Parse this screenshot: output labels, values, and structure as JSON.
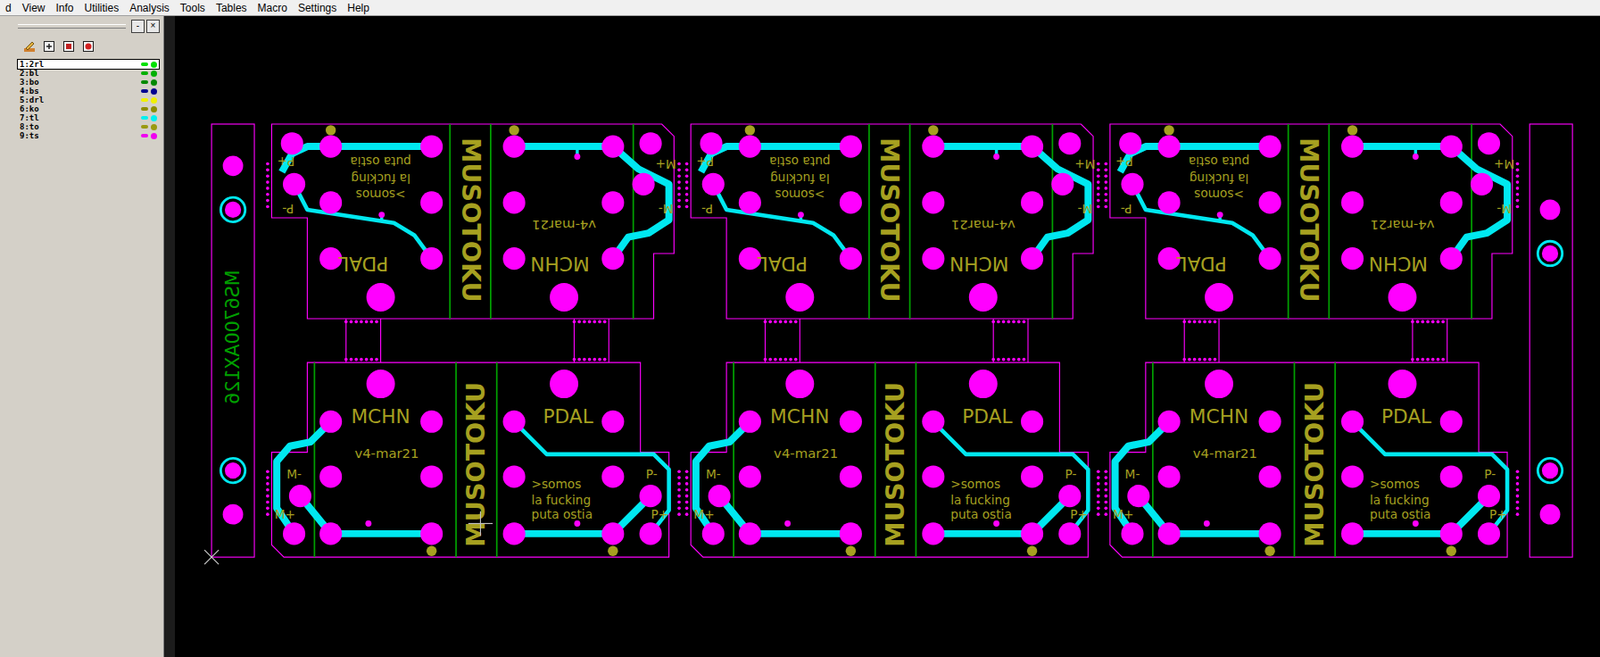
{
  "window": {
    "menu": [
      "d",
      "View",
      "Info",
      "Utilities",
      "Analysis",
      "Tools",
      "Tables",
      "Macro",
      "Settings",
      "Help"
    ]
  },
  "side_panel": {
    "buttons": [
      "-",
      "×"
    ],
    "layers": [
      {
        "name": "1:2rl",
        "selected": true,
        "color": "#00e000"
      },
      {
        "name": "2:bl",
        "selected": false,
        "color": "#00b000"
      },
      {
        "name": "3:bo",
        "selected": false,
        "color": "#008800"
      },
      {
        "name": "4:bs",
        "selected": false,
        "color": "#000090"
      },
      {
        "name": "5:drl",
        "selected": false,
        "color": "#f0f000"
      },
      {
        "name": "6:ko",
        "selected": false,
        "color": "#8c8c00"
      },
      {
        "name": "7:tl",
        "selected": false,
        "color": "#00f0f0"
      },
      {
        "name": "8:to",
        "selected": false,
        "color": "#9a9a10"
      },
      {
        "name": "9:ts",
        "selected": false,
        "color": "#f000f0"
      }
    ]
  },
  "canvas": {
    "rail_text": "MS6700AX126",
    "boards": [
      {
        "top": {
          "brand": "MUSOTOKU",
          "pedal": "PDAL",
          "machine": "MCHN",
          "version": "v4-mar21",
          "slogan": [
            ">somos",
            "la fucking",
            "puta ostia"
          ],
          "p_plus": "P+",
          "p_minus": "P-",
          "m_plus": "M+",
          "m_minus": "M-"
        },
        "bottom": {
          "brand": "MUSOTOKU",
          "pedal": "PDAL",
          "machine": "MCHN",
          "version": "v4-mar21",
          "slogan": [
            ">somos",
            "la fucking",
            "puta ostia"
          ],
          "p_plus": "P+",
          "p_minus": "P-",
          "m_plus": "M+",
          "m_minus": "M-"
        }
      },
      {
        "top": {
          "brand": "MUSOTOKU",
          "pedal": "PDAL",
          "machine": "MCHN",
          "version": "v4-mar21",
          "slogan": [
            ">somos",
            "la fucking",
            "puta ostia"
          ],
          "p_plus": "P+",
          "p_minus": "P-",
          "m_plus": "M+",
          "m_minus": "M-"
        },
        "bottom": {
          "brand": "MUSOTOKU",
          "pedal": "PDAL",
          "machine": "MCHN",
          "version": "v4-mar21",
          "slogan": [
            ">somos",
            "la fucking",
            "puta ostia"
          ],
          "p_plus": "P+",
          "p_minus": "P-",
          "m_plus": "M+",
          "m_minus": "M-"
        }
      },
      {
        "top": {
          "brand": "MUSOTOKU",
          "pedal": "PDAL",
          "machine": "MCHN",
          "version": "v4-mar21",
          "slogan": [
            ">somos",
            "la fucking",
            "puta ostia"
          ],
          "p_plus": "P+",
          "p_minus": "P-",
          "m_plus": "M+",
          "m_minus": "M-"
        },
        "bottom": {
          "brand": "MUSOTOKU",
          "pedal": "PDAL",
          "machine": "MCHN",
          "version": "v4-mar21",
          "slogan": [
            ">somos",
            "la fucking",
            "puta ostia"
          ],
          "p_plus": "P+",
          "p_minus": "P-",
          "m_plus": "M+",
          "m_minus": "M-"
        }
      }
    ]
  }
}
